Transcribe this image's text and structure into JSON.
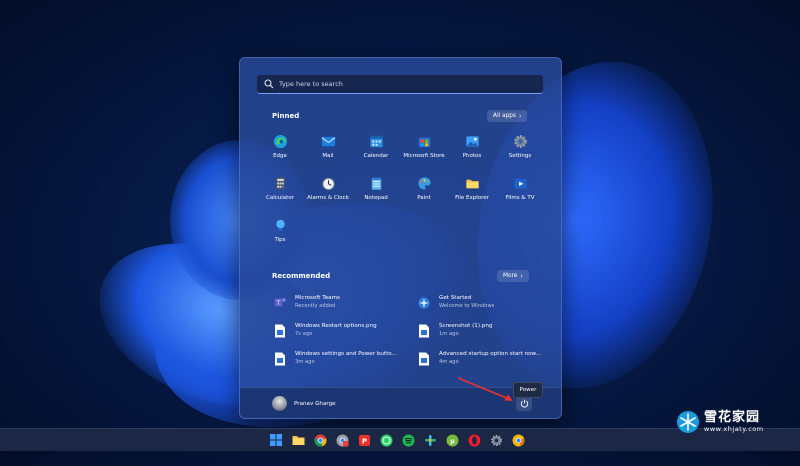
{
  "search": {
    "placeholder": "Type here to search"
  },
  "pinned": {
    "title": "Pinned",
    "all_apps_label": "All apps",
    "apps": [
      {
        "label": "Edge",
        "icon": "edge-icon"
      },
      {
        "label": "Mail",
        "icon": "mail-icon"
      },
      {
        "label": "Calendar",
        "icon": "calendar-icon"
      },
      {
        "label": "Microsoft Store",
        "icon": "store-icon"
      },
      {
        "label": "Photos",
        "icon": "photos-icon"
      },
      {
        "label": "Settings",
        "icon": "gear-icon"
      },
      {
        "label": "Calculator",
        "icon": "calculator-icon"
      },
      {
        "label": "Alarms & Clock",
        "icon": "clock-icon"
      },
      {
        "label": "Notepad",
        "icon": "notepad-icon"
      },
      {
        "label": "Paint",
        "icon": "paint-icon"
      },
      {
        "label": "File Explorer",
        "icon": "folder-icon"
      },
      {
        "label": "Films & TV",
        "icon": "film-icon"
      },
      {
        "label": "Tips",
        "icon": "lightbulb-icon"
      }
    ]
  },
  "recommended": {
    "title": "Recommended",
    "more_label": "More",
    "items": [
      {
        "name": "Microsoft Teams",
        "sub": "Recently added",
        "icon": "teams-icon"
      },
      {
        "name": "Get Started",
        "sub": "Welcome to Windows",
        "icon": "get-started-icon"
      },
      {
        "name": "Windows Restart options.png",
        "sub": "7s ago",
        "icon": "image-file-icon"
      },
      {
        "name": "Screenshot (1).png",
        "sub": "1m ago",
        "icon": "image-file-icon"
      },
      {
        "name": "Windows settings and Power butto...",
        "sub": "3m ago",
        "icon": "image-file-icon"
      },
      {
        "name": "Advanced startup option start now...",
        "sub": "4m ago",
        "icon": "image-file-icon"
      }
    ]
  },
  "footer": {
    "user_name": "Pranav Gharge",
    "power_tooltip": "Power"
  },
  "taskbar": {
    "icons": [
      "windows-start-icon",
      "file-explorer-icon",
      "chrome-icon",
      "chrome-dev-icon",
      "pdf-icon",
      "whatsapp-icon",
      "spotify-icon",
      "slack-icon",
      "utorrent-icon",
      "opera-icon",
      "settings-icon",
      "chrome-canary-icon"
    ]
  },
  "watermark": {
    "text": "雪花家园",
    "url": "www.xhjaty.com"
  },
  "colors": {
    "accent": "#3f7bff",
    "panel": "#284896",
    "taskbar": "#1b2744"
  }
}
